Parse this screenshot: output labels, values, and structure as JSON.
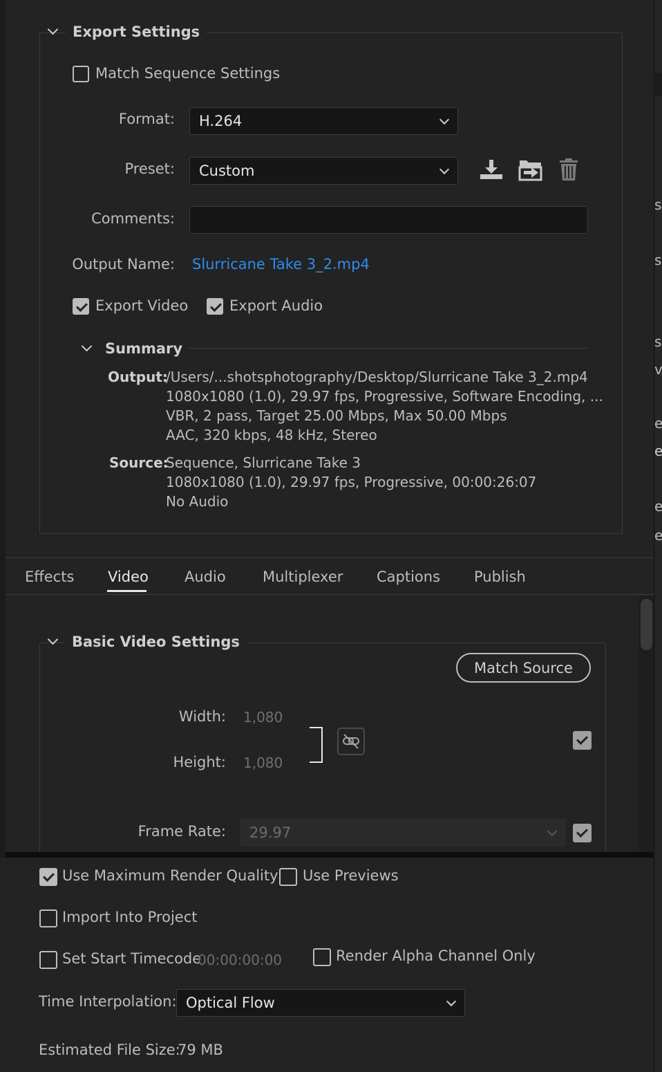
{
  "export_settings": {
    "title": "Export Settings",
    "match_sequence": {
      "label": "Match Sequence Settings",
      "checked": false
    },
    "format": {
      "label": "Format:",
      "value": "H.264"
    },
    "preset": {
      "label": "Preset:",
      "value": "Custom"
    },
    "comments": {
      "label": "Comments:",
      "value": ""
    },
    "output_name": {
      "label": "Output Name:",
      "value": "Slurricane Take 3_2.mp4",
      "color": "#2d8ceb"
    },
    "export_video": {
      "label": "Export Video",
      "checked": true
    },
    "export_audio": {
      "label": "Export Audio",
      "checked": true
    },
    "preset_icons": [
      "save-preset-icon",
      "import-preset-icon",
      "delete-preset-icon"
    ]
  },
  "summary": {
    "title": "Summary",
    "output_label": "Output:",
    "output_lines": [
      "/Users/...shotsphotography/Desktop/Slurricane Take 3_2.mp4",
      "1080x1080 (1.0), 29.97 fps, Progressive, Software Encoding, ...",
      "VBR, 2 pass, Target 25.00 Mbps, Max 50.00 Mbps",
      "AAC, 320 kbps, 48 kHz, Stereo"
    ],
    "source_label": "Source:",
    "source_lines": [
      "Sequence, Slurricane Take 3",
      "1080x1080 (1.0), 29.97 fps, Progressive, 00:00:26:07",
      "No Audio"
    ]
  },
  "tabs": [
    {
      "label": "Effects",
      "active": false
    },
    {
      "label": "Video",
      "active": true
    },
    {
      "label": "Audio",
      "active": false
    },
    {
      "label": "Multiplexer",
      "active": false
    },
    {
      "label": "Captions",
      "active": false
    },
    {
      "label": "Publish",
      "active": false
    }
  ],
  "basic_video": {
    "title": "Basic Video Settings",
    "match_source_label": "Match Source",
    "width_label": "Width:",
    "width_value": "1,080",
    "height_label": "Height:",
    "height_value": "1,080",
    "dimensions_checked": true,
    "frame_rate_label": "Frame Rate:",
    "frame_rate_value": "29.97",
    "frame_rate_checked": true
  },
  "footer": {
    "max_render_quality": {
      "label": "Use Maximum Render Quality",
      "checked": true
    },
    "use_previews": {
      "label": "Use Previews",
      "checked": false
    },
    "import_into_project": {
      "label": "Import Into Project",
      "checked": false
    },
    "set_start_timecode": {
      "label": "Set Start Timecode",
      "checked": false,
      "value": "00:00:00:00"
    },
    "render_alpha": {
      "label": "Render Alpha Channel Only",
      "checked": false
    },
    "time_interpolation": {
      "label": "Time Interpolation:",
      "value": "Optical Flow"
    },
    "estimated_size_label": "Estimated File Size:",
    "estimated_size_value": "79 MB"
  },
  "right_edge_fragments": [
    "s",
    "s",
    "s",
    "v",
    "e",
    "e",
    "e",
    "e"
  ]
}
